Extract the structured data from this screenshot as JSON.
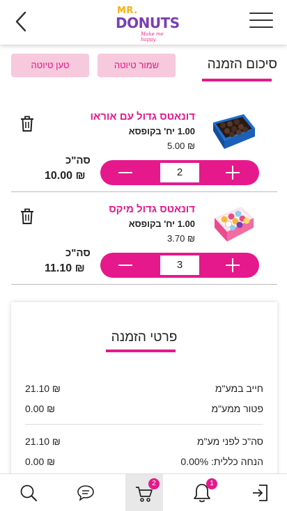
{
  "header": {
    "logo_top": "MR.",
    "logo_main": "DONUTS",
    "logo_tag": "Make me happy"
  },
  "page": {
    "title": "סיכום הזמנה",
    "save_draft_label": "שמור טיוטה",
    "load_draft_label": "טען טיוטה"
  },
  "cart_items": [
    {
      "name": "דונאטס גדול עם אוראו",
      "qty_per_box": "1.00 יח' בקופסא",
      "unit_price": "₪ 5.00",
      "total_label": "סה\"כ",
      "total_value": "₪ 10.00",
      "quantity": "2"
    },
    {
      "name": "דונאטס גדול מיקס",
      "qty_per_box": "1.00 יח' בקופסא",
      "unit_price": "₪ 3.70",
      "total_label": "סה\"כ",
      "total_value": "₪ 11.10",
      "quantity": "3"
    }
  ],
  "summary": {
    "title": "פרטי הזמנה",
    "rows": [
      {
        "label": "חייב במע\"מ",
        "value": "₪ 21.10"
      },
      {
        "label": "פטור ממע\"מ",
        "value": "₪ 0.00"
      },
      {
        "label": "סה\"כ לפני מע\"מ",
        "value": "₪ 21.10"
      },
      {
        "label": "הנחה כללית: 0.00%",
        "value": "₪ 0.00"
      }
    ]
  },
  "bottom_nav": {
    "cart_badge": "2",
    "notifications_badge": "1"
  },
  "colors": {
    "accent": "#e5198c",
    "pill_bg": "#f6c9dd"
  }
}
